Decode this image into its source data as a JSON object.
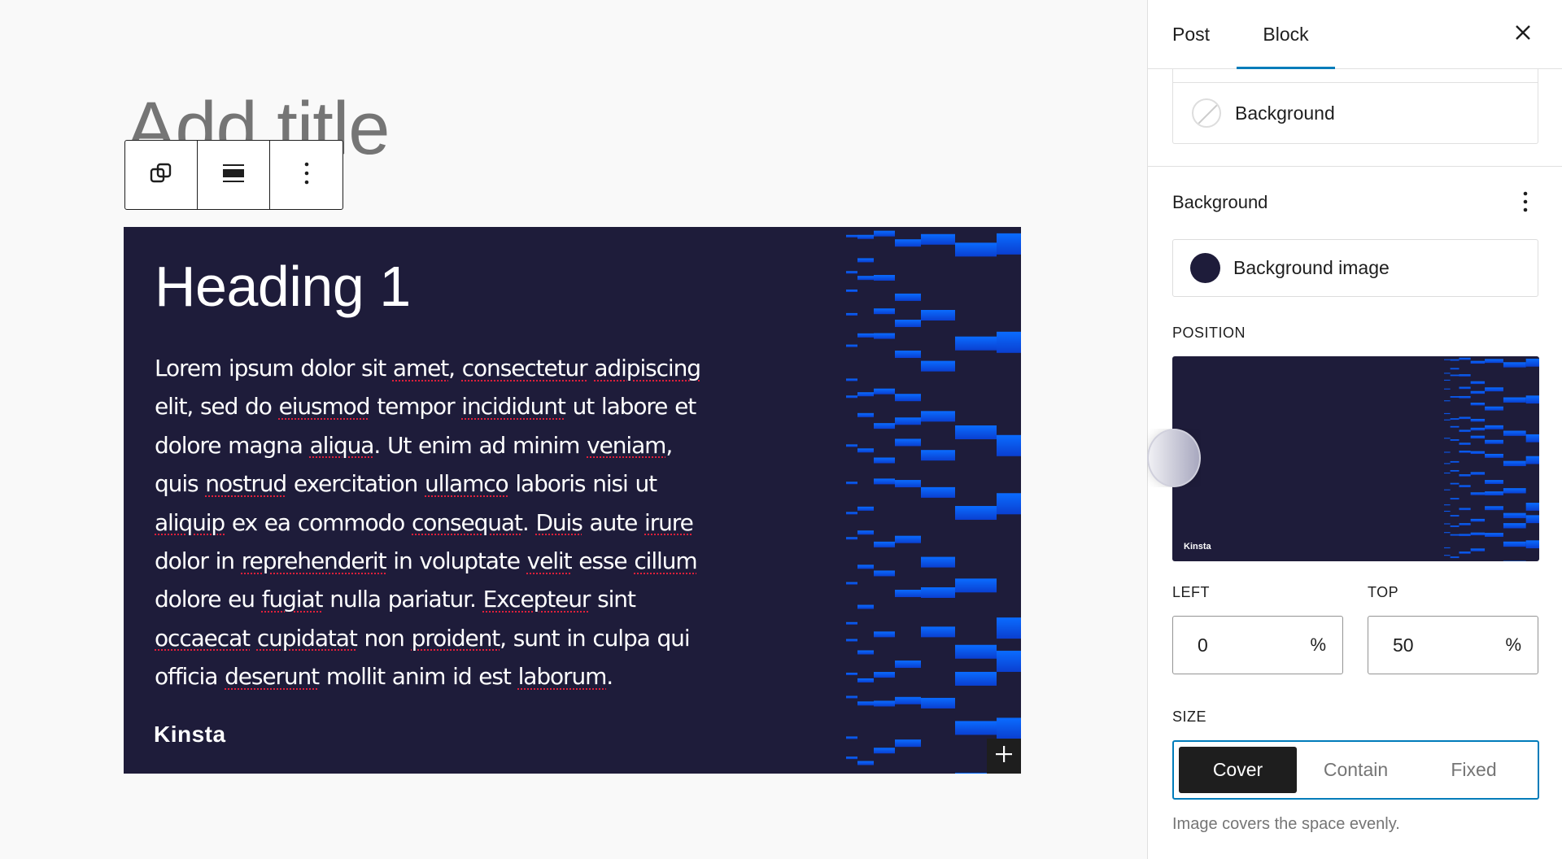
{
  "editor": {
    "title_placeholder": "Add title",
    "toolbar": {
      "buttons": [
        {
          "name": "block-type-icon",
          "label": "Cover"
        },
        {
          "name": "align-icon",
          "label": "Align"
        },
        {
          "name": "more-options-icon",
          "label": "Options"
        }
      ]
    },
    "cover": {
      "heading": "Heading 1",
      "paragraph_lines": [
        [
          [
            "Lorem ipsum dolor sit ",
            false
          ],
          [
            "amet",
            true
          ],
          [
            ", ",
            false
          ],
          [
            "consectetur",
            true
          ],
          [
            " ",
            false
          ],
          [
            "adipiscing",
            true
          ]
        ],
        [
          [
            "elit, sed do ",
            false
          ],
          [
            "eiusmod",
            true
          ],
          [
            " tempor ",
            false
          ],
          [
            "incididunt",
            true
          ],
          [
            " ut labore et",
            false
          ]
        ],
        [
          [
            "dolore magna ",
            false
          ],
          [
            "aliqua",
            true
          ],
          [
            ". Ut enim ad minim ",
            false
          ],
          [
            "veniam",
            true
          ],
          [
            ",",
            false
          ]
        ],
        [
          [
            "quis ",
            false
          ],
          [
            "nostrud",
            true
          ],
          [
            " exercitation ",
            false
          ],
          [
            "ullamco",
            true
          ],
          [
            " laboris nisi ut",
            false
          ]
        ],
        [
          [
            "aliquip",
            true
          ],
          [
            " ex ea commodo ",
            false
          ],
          [
            "consequat",
            true
          ],
          [
            ". ",
            false
          ],
          [
            "Duis",
            true
          ],
          [
            " aute ",
            false
          ],
          [
            "irure",
            true
          ]
        ],
        [
          [
            "dolor in ",
            false
          ],
          [
            "reprehenderit",
            true
          ],
          [
            " in voluptate ",
            false
          ],
          [
            "velit",
            true
          ],
          [
            " esse ",
            false
          ],
          [
            "cillum",
            true
          ]
        ],
        [
          [
            "dolore eu ",
            false
          ],
          [
            "fugiat",
            true
          ],
          [
            " nulla pariatur. ",
            false
          ],
          [
            "Excepteur",
            true
          ],
          [
            " sint",
            false
          ]
        ],
        [
          [
            "occaecat",
            true
          ],
          [
            " ",
            false
          ],
          [
            "cupidatat",
            true
          ],
          [
            " non ",
            false
          ],
          [
            "proident",
            true
          ],
          [
            ", sunt in culpa qui",
            false
          ]
        ],
        [
          [
            "officia ",
            false
          ],
          [
            "deserunt",
            true
          ],
          [
            " mollit anim id est ",
            false
          ],
          [
            "laborum",
            true
          ],
          [
            ".",
            false
          ]
        ]
      ],
      "logo_text": "Kinsta",
      "background_color": "#1e1c3a",
      "pattern_color": "#0a6cff",
      "add_block_label": "+"
    }
  },
  "sidebar": {
    "tabs": [
      {
        "label": "Post",
        "active": false
      },
      {
        "label": "Block",
        "active": true
      }
    ],
    "close_label": "Close settings",
    "color_panel": {
      "item_label": "Background"
    },
    "background_panel": {
      "title": "Background",
      "image_item_label": "Background image",
      "position_label": "POSITION",
      "focal_logo": "Kinsta",
      "left_label": "LEFT",
      "left_value": "0",
      "top_label": "TOP",
      "top_value": "50",
      "unit": "%",
      "size_label": "SIZE",
      "size_options": [
        "Cover",
        "Contain",
        "Fixed"
      ],
      "size_selected": "Cover",
      "size_help": "Image covers the space evenly."
    },
    "accent_color": "#007cba"
  }
}
